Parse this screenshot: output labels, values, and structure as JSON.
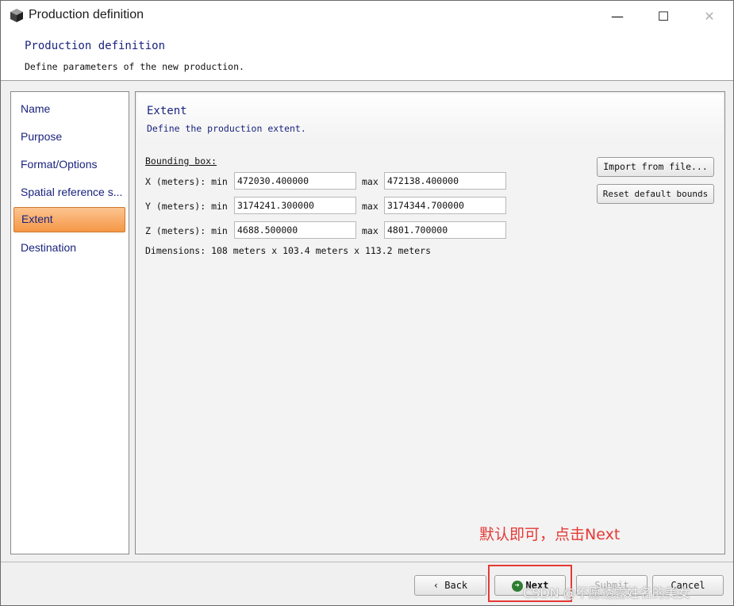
{
  "window": {
    "title": "Production definition",
    "controls": {
      "minimize": "—",
      "maximize": "☐",
      "close": "✕"
    }
  },
  "header": {
    "title": "Production definition",
    "subtitle": "Define parameters of the new production."
  },
  "sidebar": {
    "items": [
      {
        "label": "Name",
        "active": false
      },
      {
        "label": "Purpose",
        "active": false
      },
      {
        "label": "Format/Options",
        "active": false
      },
      {
        "label": "Spatial reference s...",
        "active": false
      },
      {
        "label": "Extent",
        "active": true
      },
      {
        "label": "Destination",
        "active": false
      }
    ]
  },
  "main": {
    "title": "Extent",
    "subtitle": "Define the production extent.",
    "bounding_box_label": "Bounding box:",
    "rows": [
      {
        "label": "X (meters): min",
        "min": "472030.400000",
        "max_label": "max",
        "max": "472138.400000"
      },
      {
        "label": "Y (meters): min",
        "min": "3174241.300000",
        "max_label": "max",
        "max": "3174344.700000"
      },
      {
        "label": "Z (meters): min",
        "min": "4688.500000",
        "max_label": "max",
        "max": "4801.700000"
      }
    ],
    "dimensions": "Dimensions: 108 meters x 103.4 meters x 113.2 meters",
    "import_button": "Import from file...",
    "reset_button": "Reset default bounds"
  },
  "annotation": "默认即可，点击Next",
  "footer": {
    "back": "‹ Back",
    "next": "Next",
    "submit": "Submit",
    "cancel": "Cancel"
  },
  "watermark": "CSDN @不愿透露姓名的美女",
  "colors": {
    "accent_text": "#1a237e",
    "active_item": "#f59746",
    "annotation": "#e53935"
  }
}
